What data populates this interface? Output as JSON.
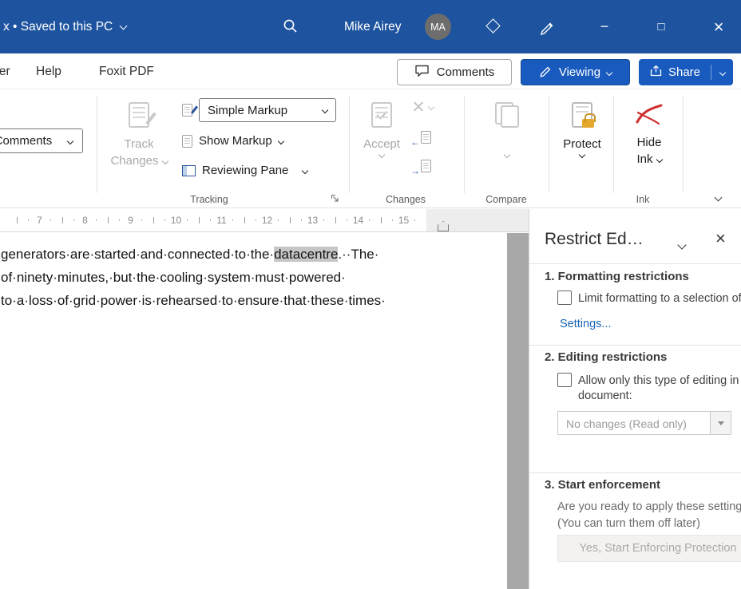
{
  "titlebar": {
    "saved_status": "x • Saved to this PC",
    "user_name": "Mike Airey",
    "avatar_initials": "MA",
    "minimize_glyph": "−",
    "maximize_glyph": "□",
    "close_glyph": "×"
  },
  "menubar": {
    "tabs": [
      {
        "label": "Developer"
      },
      {
        "label": "Help"
      },
      {
        "label": "Foxit PDF"
      }
    ],
    "comments_label": "Comments",
    "viewing_label": "Viewing",
    "share_label": "Share"
  },
  "ribbon": {
    "show_comments_label": "Show Comments",
    "track_label_1": "Track",
    "track_label_2": "Changes",
    "display_for_review": "Simple Markup",
    "show_markup": "Show Markup",
    "reviewing_pane": "Reviewing Pane",
    "accept": "Accept",
    "protect": "Protect",
    "hide_1": "Hide",
    "hide_2": "Ink",
    "groups": {
      "tracking": "Tracking",
      "changes": "Changes",
      "compare": "Compare",
      "ink": "Ink"
    }
  },
  "ruler": {
    "numbers": [
      "7",
      "8",
      "9",
      "10",
      "11",
      "12",
      "13",
      "14",
      "15"
    ]
  },
  "document": {
    "line1_pre": "generators·are·started·and·connected·to·the·",
    "line1_highlight": "datacentre",
    "line1_post": ".··The·",
    "line2": "of·ninety·minutes,·but·the·cooling·system·must·powered·",
    "line3": "to·a·loss·of·grid·power·is·rehearsed·to·ensure·that·these·times·"
  },
  "restrict_pane": {
    "title": "Restrict Editing",
    "formatting": {
      "heading": "1. Formatting restrictions",
      "checkbox_label": "Limit formatting to a selection of styles",
      "settings_link": "Settings..."
    },
    "editing": {
      "heading": "2. Editing restrictions",
      "checkbox_label_line1": "Allow only this type of editing in the",
      "checkbox_label_line2": "document:",
      "dropdown_value": "No changes (Read only)"
    },
    "enforcement": {
      "heading": "3. Start enforcement",
      "description_line1": "Are you ready to apply these settings?",
      "description_line2": "(You can turn them off later)",
      "button_label": "Yes, Start Enforcing Protection"
    }
  },
  "colors": {
    "titlebar_blue": "#1e549f",
    "accent_blue": "#185abd",
    "selection_highlight": "#c6c6c6",
    "link_blue": "#1866b4",
    "ink_red": "#cf2e2e",
    "lock_gold": "#e3a82d",
    "canvas_gray": "#a8a8a8"
  }
}
